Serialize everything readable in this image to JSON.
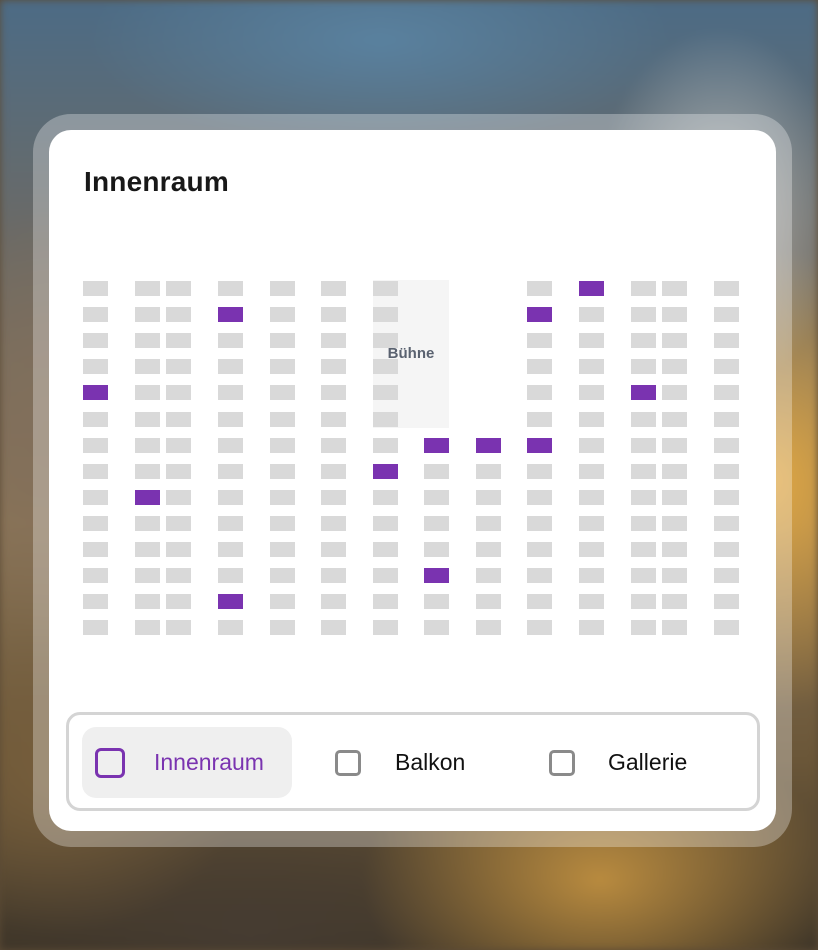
{
  "panel": {
    "title": "Innenraum"
  },
  "stage_label": "Bühne",
  "seat_map": {
    "rows": 14,
    "columns": 14,
    "stage_columns": [
      7,
      8
    ],
    "stage_rows": 6,
    "selected_seats": [
      [
        0,
        10
      ],
      [
        1,
        3
      ],
      [
        1,
        9
      ],
      [
        4,
        0
      ],
      [
        4,
        11
      ],
      [
        6,
        7
      ],
      [
        6,
        8
      ],
      [
        6,
        9
      ],
      [
        7,
        6
      ],
      [
        8,
        1
      ],
      [
        11,
        7
      ],
      [
        12,
        3
      ]
    ],
    "colors": {
      "seat": "#d9d9d9",
      "selected": "#7a33b0",
      "stage": "#f5f5f5"
    }
  },
  "tabs": [
    {
      "label": "Innenraum",
      "active": true,
      "icon": "checkbox-icon"
    },
    {
      "label": "Balkon",
      "active": false,
      "icon": "checkbox-icon"
    },
    {
      "label": "Gallerie",
      "active": false,
      "icon": "checkbox-icon"
    }
  ],
  "colors": {
    "accent": "#7a33b0",
    "text": "#181818"
  }
}
